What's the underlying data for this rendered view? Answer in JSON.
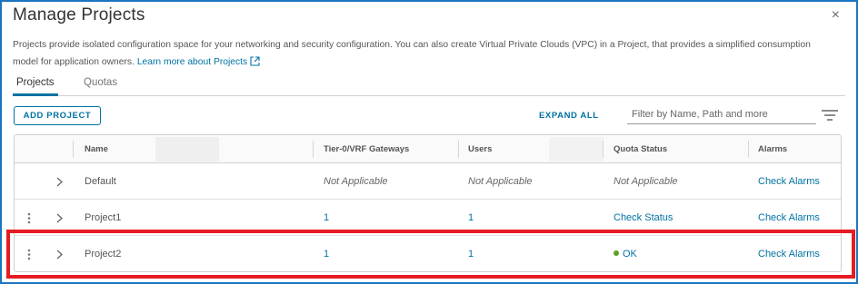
{
  "dialog": {
    "title": "Manage Projects",
    "close_label": "×",
    "description": "Projects provide isolated configuration space for your networking and security configuration. You can also create Virtual Private Clouds (VPC) in a Project, that provides a simplified consumption model for application owners.",
    "learn_more": "Learn more about Projects"
  },
  "tabs": [
    {
      "label": "Projects",
      "active": true
    },
    {
      "label": "Quotas",
      "active": false
    }
  ],
  "toolbar": {
    "add_label": "ADD PROJECT",
    "expand_label": "EXPAND ALL",
    "filter_placeholder": "Filter by Name, Path and more"
  },
  "table": {
    "headers": {
      "name": "Name",
      "gateways": "Tier-0/VRF Gateways",
      "users": "Users",
      "quota": "Quota Status",
      "alarms": "Alarms"
    },
    "rows": [
      {
        "name": "Default",
        "gateways": "Not Applicable",
        "users": "Not Applicable",
        "quota": "Not Applicable",
        "alarms": "Check Alarms"
      },
      {
        "name": "Project1",
        "gateways": "1",
        "users": "1",
        "quota": "Check Status",
        "alarms": "Check Alarms"
      },
      {
        "name": "Project2",
        "gateways": "1",
        "users": "1",
        "quota": "OK",
        "alarms": "Check Alarms"
      }
    ]
  },
  "colors": {
    "accent": "#0072a3",
    "ok_status": "#5aa220",
    "highlight": "#e51c23",
    "frame": "#1a75c1"
  }
}
